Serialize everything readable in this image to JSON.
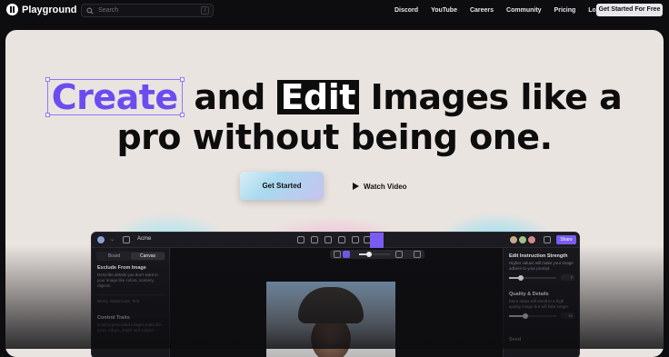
{
  "nav": {
    "brand": "Playground",
    "search_placeholder": "Search",
    "search_shortcut": "/",
    "links": [
      "Discord",
      "YouTube",
      "Careers",
      "Community",
      "Pricing",
      "Log in"
    ],
    "cta": "Get Started For Free"
  },
  "hero": {
    "word_create": "Create",
    "text_and": "and",
    "word_edit": "Edit",
    "line1_rest": "Images like a",
    "line2": "pro without being one.",
    "primary_button": "Get Started",
    "secondary_button": "Watch Video"
  },
  "app": {
    "doc_title": "Acme",
    "share_label": "Share",
    "tabs": [
      "Board",
      "Canvas"
    ],
    "left_sections": [
      {
        "title": "Exclude From Image",
        "desc": "Describe details you don't want in your image like colors, scenery, objects.",
        "hint": "Blurry, Watermark, Text"
      },
      {
        "title": "Control Traits",
        "desc": "Control generated images traits like pose, edges, depth and subject."
      }
    ],
    "right_sections": [
      {
        "title": "Edit Instruction Strength",
        "desc": "Higher values will make your image adhere to your prompt.",
        "value": "7",
        "level": 0.25
      },
      {
        "title": "Quality & Details",
        "desc": "More steps will result in a high quality image but will take longer.",
        "value": "50",
        "level": 0.35
      },
      {
        "title": "Seed"
      }
    ]
  },
  "colors": {
    "accent": "#6b4cf0",
    "hero_bg": "#eae4e0",
    "nav_bg": "#0d0d10"
  }
}
